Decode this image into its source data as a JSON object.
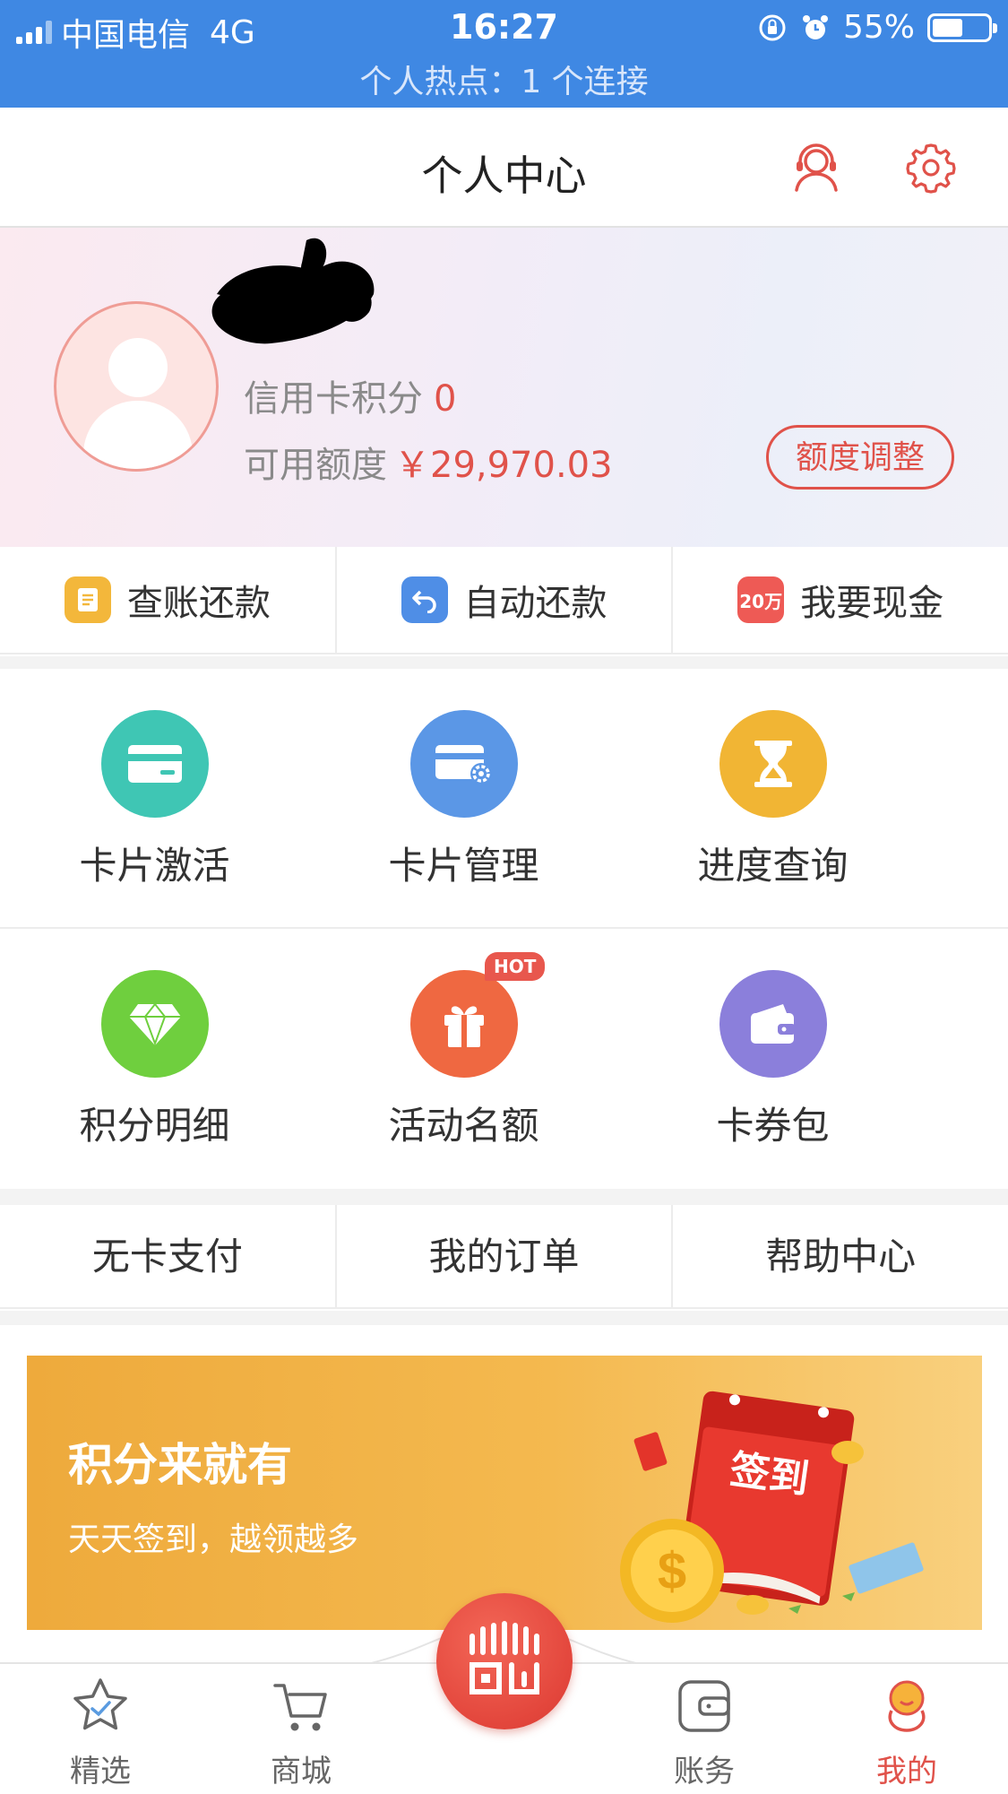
{
  "status_bar": {
    "carrier": "中国电信",
    "network": "4G",
    "time": "16:27",
    "battery": "55%",
    "battery_level": 0.55,
    "hotspot": "个人热点：1 个连接"
  },
  "header": {
    "title": "个人中心"
  },
  "profile": {
    "points_label": "信用卡积分",
    "points_value": "0",
    "limit_label": "可用额度",
    "limit_value": "￥29,970.03",
    "adjust_label": "额度调整"
  },
  "quick_actions": [
    {
      "label": "查账还款",
      "color": "#f3b73b"
    },
    {
      "label": "自动还款",
      "color": "#4f8ee6"
    },
    {
      "label": "我要现金",
      "badge": "20万",
      "color": "#ee5a55"
    }
  ],
  "grid": [
    {
      "label": "卡片激活",
      "icon": "card-icon",
      "color": "#3fc6b4"
    },
    {
      "label": "卡片管理",
      "icon": "card-settings-icon",
      "color": "#5b97e6"
    },
    {
      "label": "进度查询",
      "icon": "hourglass-icon",
      "color": "#f1b534"
    },
    {
      "label": "积分明细",
      "icon": "diamond-icon",
      "color": "#6fcf3e"
    },
    {
      "label": "活动名额",
      "icon": "gift-icon",
      "color": "#ef6841",
      "badge": "HOT"
    },
    {
      "label": "卡券包",
      "icon": "wallet-icon",
      "color": "#8b7fdb"
    }
  ],
  "links": [
    {
      "label": "无卡支付"
    },
    {
      "label": "我的订单"
    },
    {
      "label": "帮助中心"
    }
  ],
  "banner": {
    "headline": "积分来就有",
    "subline": "天天签到，越领越多",
    "calendar_text": "签到",
    "coin_text": "$"
  },
  "tabbar": [
    {
      "label": "精选",
      "icon": "star-icon"
    },
    {
      "label": "商城",
      "icon": "cart-icon"
    },
    {
      "label": "账务",
      "icon": "bill-icon"
    },
    {
      "label": "我的",
      "icon": "profile-icon",
      "active": true
    }
  ],
  "accent_color": "#e0524a"
}
